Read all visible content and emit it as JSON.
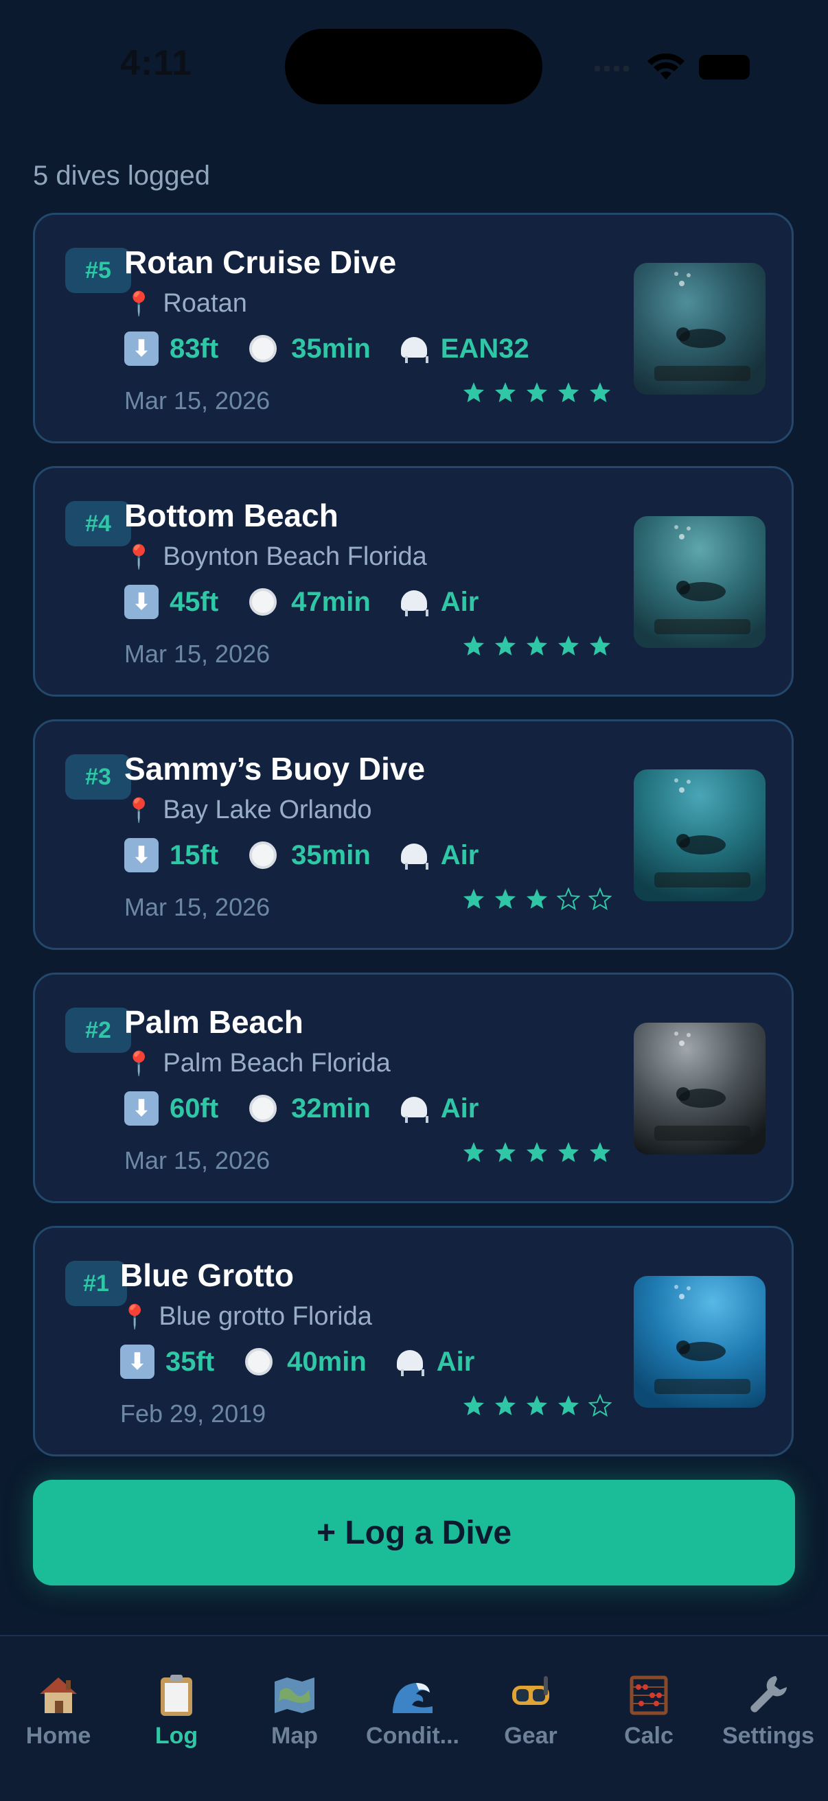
{
  "status_bar": {
    "time": "4:11"
  },
  "summary": {
    "count_text": "5 dives logged"
  },
  "dives": [
    {
      "number": "#5",
      "title": "Rotan Cruise Dive",
      "location": "Roatan",
      "depth": "83ft",
      "duration": "35min",
      "gas": "EAN32",
      "date": "Mar 15, 2026",
      "rating": 5
    },
    {
      "number": "#4",
      "title": "Bottom Beach",
      "location": "Boynton Beach Florida",
      "depth": "45ft",
      "duration": "47min",
      "gas": "Air",
      "date": "Mar 15, 2026",
      "rating": 5
    },
    {
      "number": "#3",
      "title": "Sammy’s Buoy Dive",
      "location": "Bay Lake Orlando",
      "depth": "15ft",
      "duration": "35min",
      "gas": "Air",
      "date": "Mar 15, 2026",
      "rating": 3
    },
    {
      "number": "#2",
      "title": "Palm Beach",
      "location": "Palm Beach Florida",
      "depth": "60ft",
      "duration": "32min",
      "gas": "Air",
      "date": "Mar 15, 2026",
      "rating": 5
    },
    {
      "number": "#1",
      "title": "Blue Grotto",
      "location": "Blue grotto Florida",
      "depth": "35ft",
      "duration": "40min",
      "gas": "Air",
      "date": "Feb 29, 2019",
      "rating": 4
    }
  ],
  "actions": {
    "log_dive_label": "+ Log a Dive"
  },
  "tabs": [
    {
      "label": "Home",
      "icon": "house-icon",
      "active": false
    },
    {
      "label": "Log",
      "icon": "clipboard-icon",
      "active": true
    },
    {
      "label": "Map",
      "icon": "map-icon",
      "active": false
    },
    {
      "label": "Condit...",
      "icon": "wave-icon",
      "active": false
    },
    {
      "label": "Gear",
      "icon": "goggles-icon",
      "active": false
    },
    {
      "label": "Calc",
      "icon": "abacus-icon",
      "active": false
    },
    {
      "label": "Settings",
      "icon": "wrench-icon",
      "active": false
    }
  ],
  "colors": {
    "accent": "#1bbd98",
    "accent_text": "#2fc7a6",
    "background": "#0b1a2e",
    "card": "#13223f",
    "star": "#2fc7a6"
  }
}
